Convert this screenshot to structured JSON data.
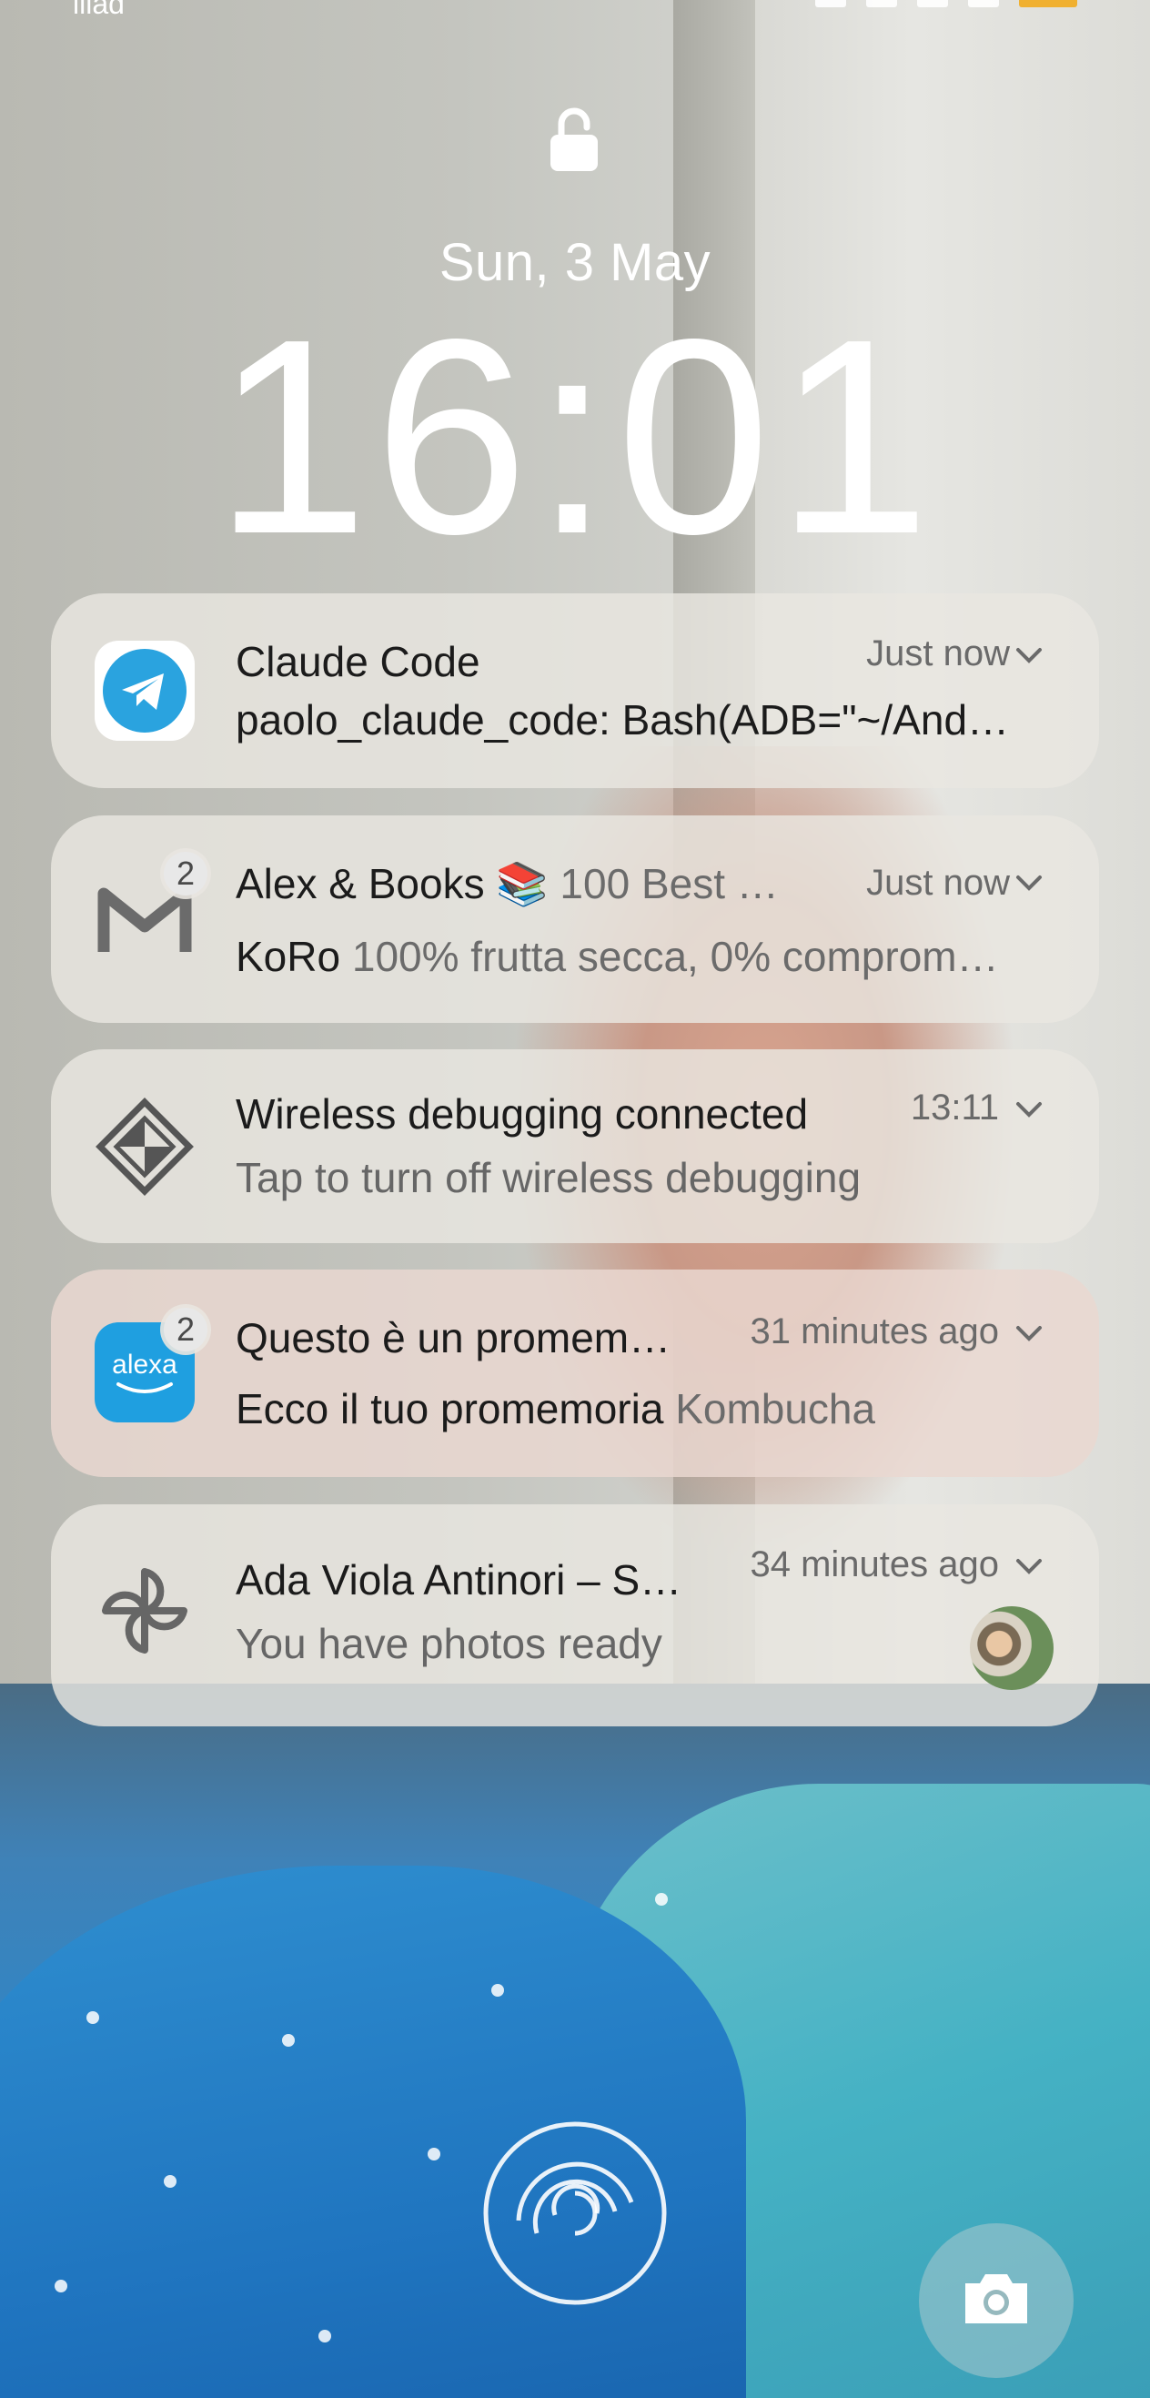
{
  "status_bar": {
    "carrier": "iliad",
    "icons": [
      "nfc-icon",
      "vibrate-icon",
      "wifi-icon",
      "signal-icon",
      "battery-icon"
    ]
  },
  "lock_screen": {
    "date": "Sun, 3 May",
    "time": "16:01"
  },
  "notifications": [
    {
      "app": "Telegram",
      "icon": "telegram-icon",
      "title": "Claude Code",
      "sender": "paolo_claude_code:",
      "body": "Bash(ADB=\"~/And…",
      "time": "Just now"
    },
    {
      "app": "Gmail",
      "icon": "gmail-icon",
      "badge": "2",
      "title": "Alex & Books 📚",
      "title_extra": "100 Best …",
      "sender": "KoRo",
      "body": "100% frutta secca, 0% comprom…",
      "time": "Just now"
    },
    {
      "app": "Android System",
      "icon": "developer-options-icon",
      "title": "Wireless debugging connected",
      "body": "Tap to turn off wireless debugging",
      "time": "13:11"
    },
    {
      "app": "Amazon Alexa",
      "icon": "alexa-icon",
      "icon_label": "alexa",
      "badge": "2",
      "title": "Questo è un promem…",
      "sender": "Ecco il tuo promemoria",
      "body": "Kombucha",
      "time": "31 minutes ago"
    },
    {
      "app": "Google Photos",
      "icon": "pinwheel-icon",
      "title": "Ada Viola Antinori – S…",
      "body": "You have photos ready",
      "time": "34 minutes ago"
    }
  ],
  "colors": {
    "telegram": "#2aa3df",
    "alexa": "#1f9fe0",
    "battery": "#f0b030",
    "notification_bg": "#e9e6e0"
  }
}
